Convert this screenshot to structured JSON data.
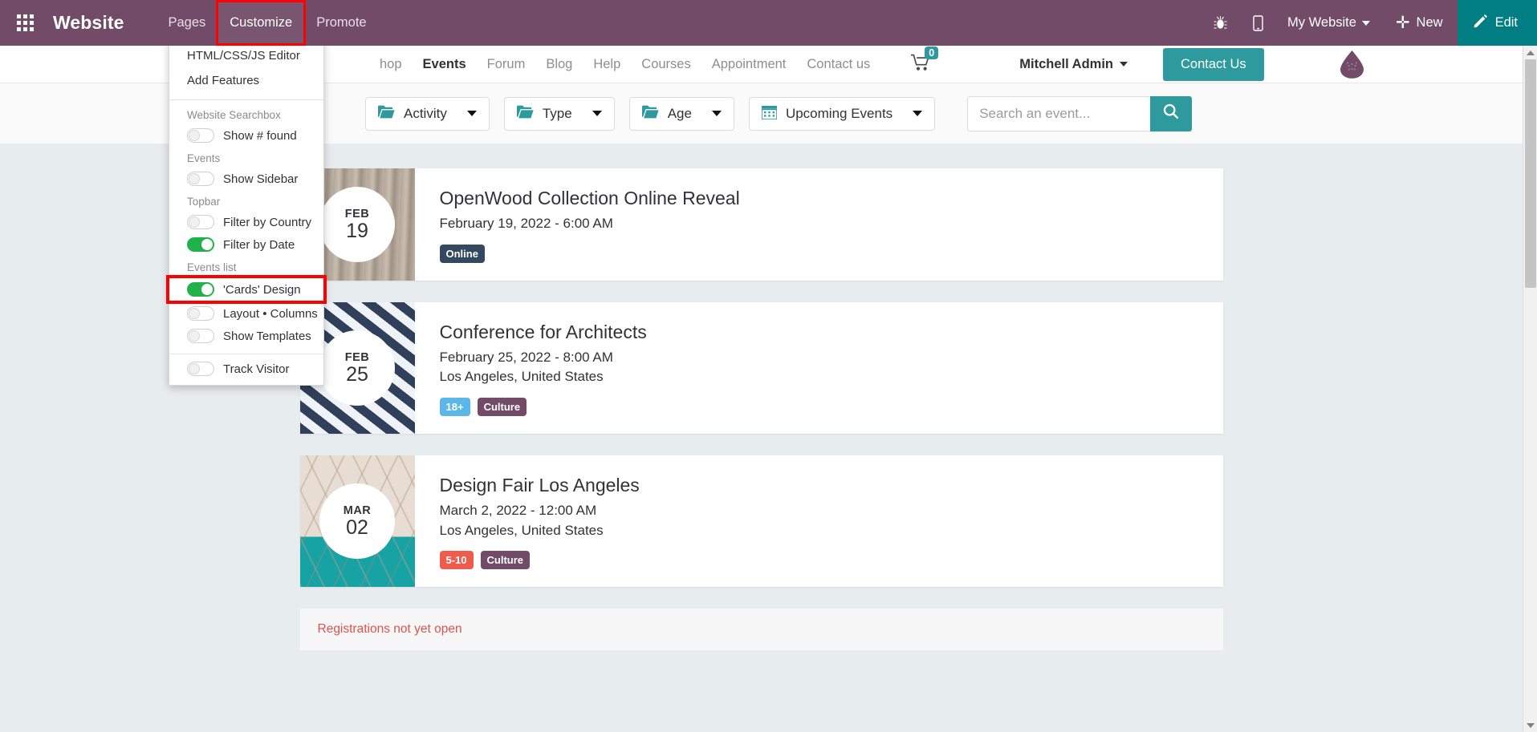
{
  "backend": {
    "brand": "Website",
    "apps_icon": "apps-grid-icon",
    "menu": [
      {
        "label": "Pages",
        "active": false,
        "highlighted": false
      },
      {
        "label": "Customize",
        "active": true,
        "highlighted": true
      },
      {
        "label": "Promote",
        "active": false,
        "highlighted": false
      }
    ],
    "right": {
      "bug_icon": "bug-icon",
      "mobile_icon": "mobile-preview-icon",
      "website_selector": "My Website",
      "new_label": "New",
      "new_icon": "plus-icon",
      "edit_label": "Edit",
      "edit_icon": "pencil-icon"
    },
    "colors": {
      "navbar": "#714b67",
      "edit_button": "#017e84",
      "highlight": "#ff0000"
    }
  },
  "customize_menu": {
    "links": [
      "HTML/CSS/JS Editor",
      "Add Features"
    ],
    "groups": [
      {
        "title": "Website Searchbox",
        "items": [
          {
            "label": "Show # found",
            "on": false,
            "highlighted": false
          }
        ]
      },
      {
        "title": "Events",
        "items": [
          {
            "label": "Show Sidebar",
            "on": false,
            "highlighted": false
          }
        ]
      },
      {
        "title": "Topbar",
        "items": [
          {
            "label": "Filter by Country",
            "on": false,
            "highlighted": false
          },
          {
            "label": "Filter by Date",
            "on": true,
            "highlighted": false
          }
        ]
      },
      {
        "title": "Events list",
        "items": [
          {
            "label": "'Cards' Design",
            "on": true,
            "highlighted": true
          },
          {
            "label": "Layout • Columns",
            "on": false,
            "highlighted": false
          },
          {
            "label": "Show Templates",
            "on": false,
            "highlighted": false
          }
        ]
      },
      {
        "title": "",
        "items": [
          {
            "label": "Track Visitor",
            "on": false,
            "highlighted": false
          }
        ]
      }
    ]
  },
  "site_header": {
    "nav": [
      {
        "label": "hop",
        "current": false
      },
      {
        "label": "Events",
        "current": true
      },
      {
        "label": "Forum",
        "current": false
      },
      {
        "label": "Blog",
        "current": false
      },
      {
        "label": "Help",
        "current": false
      },
      {
        "label": "Courses",
        "current": false
      },
      {
        "label": "Appointment",
        "current": false
      },
      {
        "label": "Contact us",
        "current": false
      }
    ],
    "cart_icon": "shopping-cart-icon",
    "cart_count": "0",
    "user": "Mitchell Admin",
    "contact_button": "Contact Us",
    "logo_icon": "water-drop-logo-icon"
  },
  "filters": {
    "buttons": [
      {
        "label": "Activity",
        "icon": "folder-icon",
        "caret": true
      },
      {
        "label": "Type",
        "icon": "folder-icon",
        "caret": true
      },
      {
        "label": "Age",
        "icon": "folder-icon",
        "caret": true
      },
      {
        "label": "Upcoming Events",
        "icon": "calendar-icon",
        "caret": true
      }
    ],
    "search": {
      "value": "",
      "placeholder": "Search an event...",
      "button_icon": "search-icon"
    }
  },
  "events": [
    {
      "month": "FEB",
      "day": "19",
      "title": "OpenWood Collection Online Reveal",
      "datetime": "February 19, 2022 - 6:00 AM",
      "location": "",
      "tags": [
        {
          "label": "Online",
          "color": "#34495e"
        }
      ],
      "image": "wood-planks-photo"
    },
    {
      "month": "FEB",
      "day": "25",
      "title": "Conference for Architects",
      "datetime": "February 25, 2022 - 8:00 AM",
      "location": "Los Angeles, United States",
      "tags": [
        {
          "label": "18+",
          "color": "#5bb7e8"
        },
        {
          "label": "Culture",
          "color": "#714b67"
        }
      ],
      "image": "checkered-pattern-photo"
    },
    {
      "month": "MAR",
      "day": "02",
      "title": "Design Fair Los Angeles",
      "datetime": "March 2, 2022 - 12:00 AM",
      "location": "Los Angeles, United States",
      "tags": [
        {
          "label": "5-10",
          "color": "#ef5b4c"
        },
        {
          "label": "Culture",
          "color": "#714b67"
        }
      ],
      "image": "create-mural-photo",
      "note": "Registrations not yet open"
    }
  ]
}
